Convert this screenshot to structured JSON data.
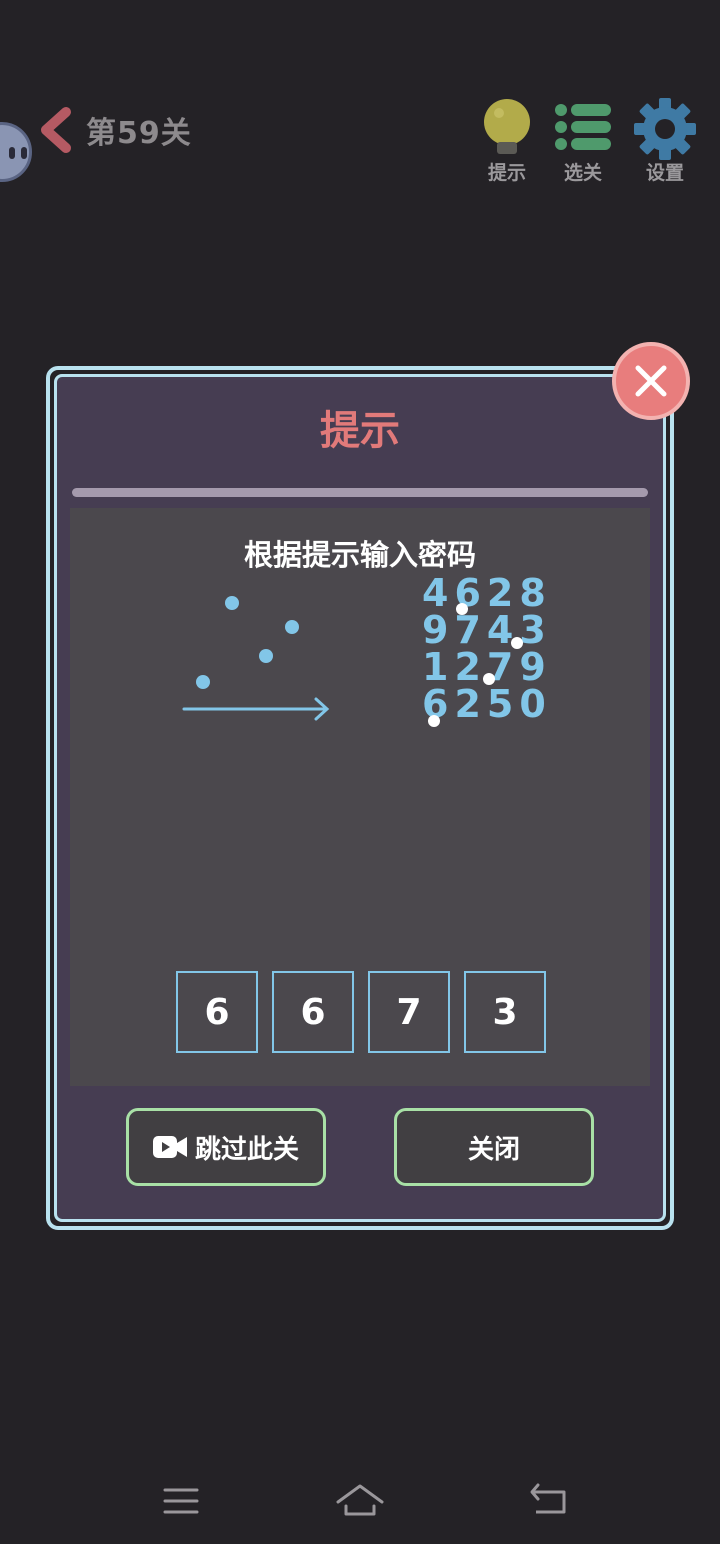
{
  "header": {
    "level_title": "第59关",
    "buttons": [
      {
        "label": "提示",
        "icon": "lightbulb-icon"
      },
      {
        "label": "选关",
        "icon": "list-icon"
      },
      {
        "label": "设置",
        "icon": "gear-icon"
      }
    ]
  },
  "dialog": {
    "title": "提示",
    "prompt": "根据提示输入密码",
    "hint_rows": [
      "4628",
      "9743",
      "1279",
      "6250"
    ],
    "code": [
      "6",
      "6",
      "7",
      "3"
    ],
    "skip_label": "跳过此关",
    "close_label": "关闭"
  },
  "colors": {
    "accent_blue": "#82c6e8",
    "title_red": "#e27a7a",
    "button_border_green": "#a8e0a6",
    "frame": "#b9e2ef"
  }
}
